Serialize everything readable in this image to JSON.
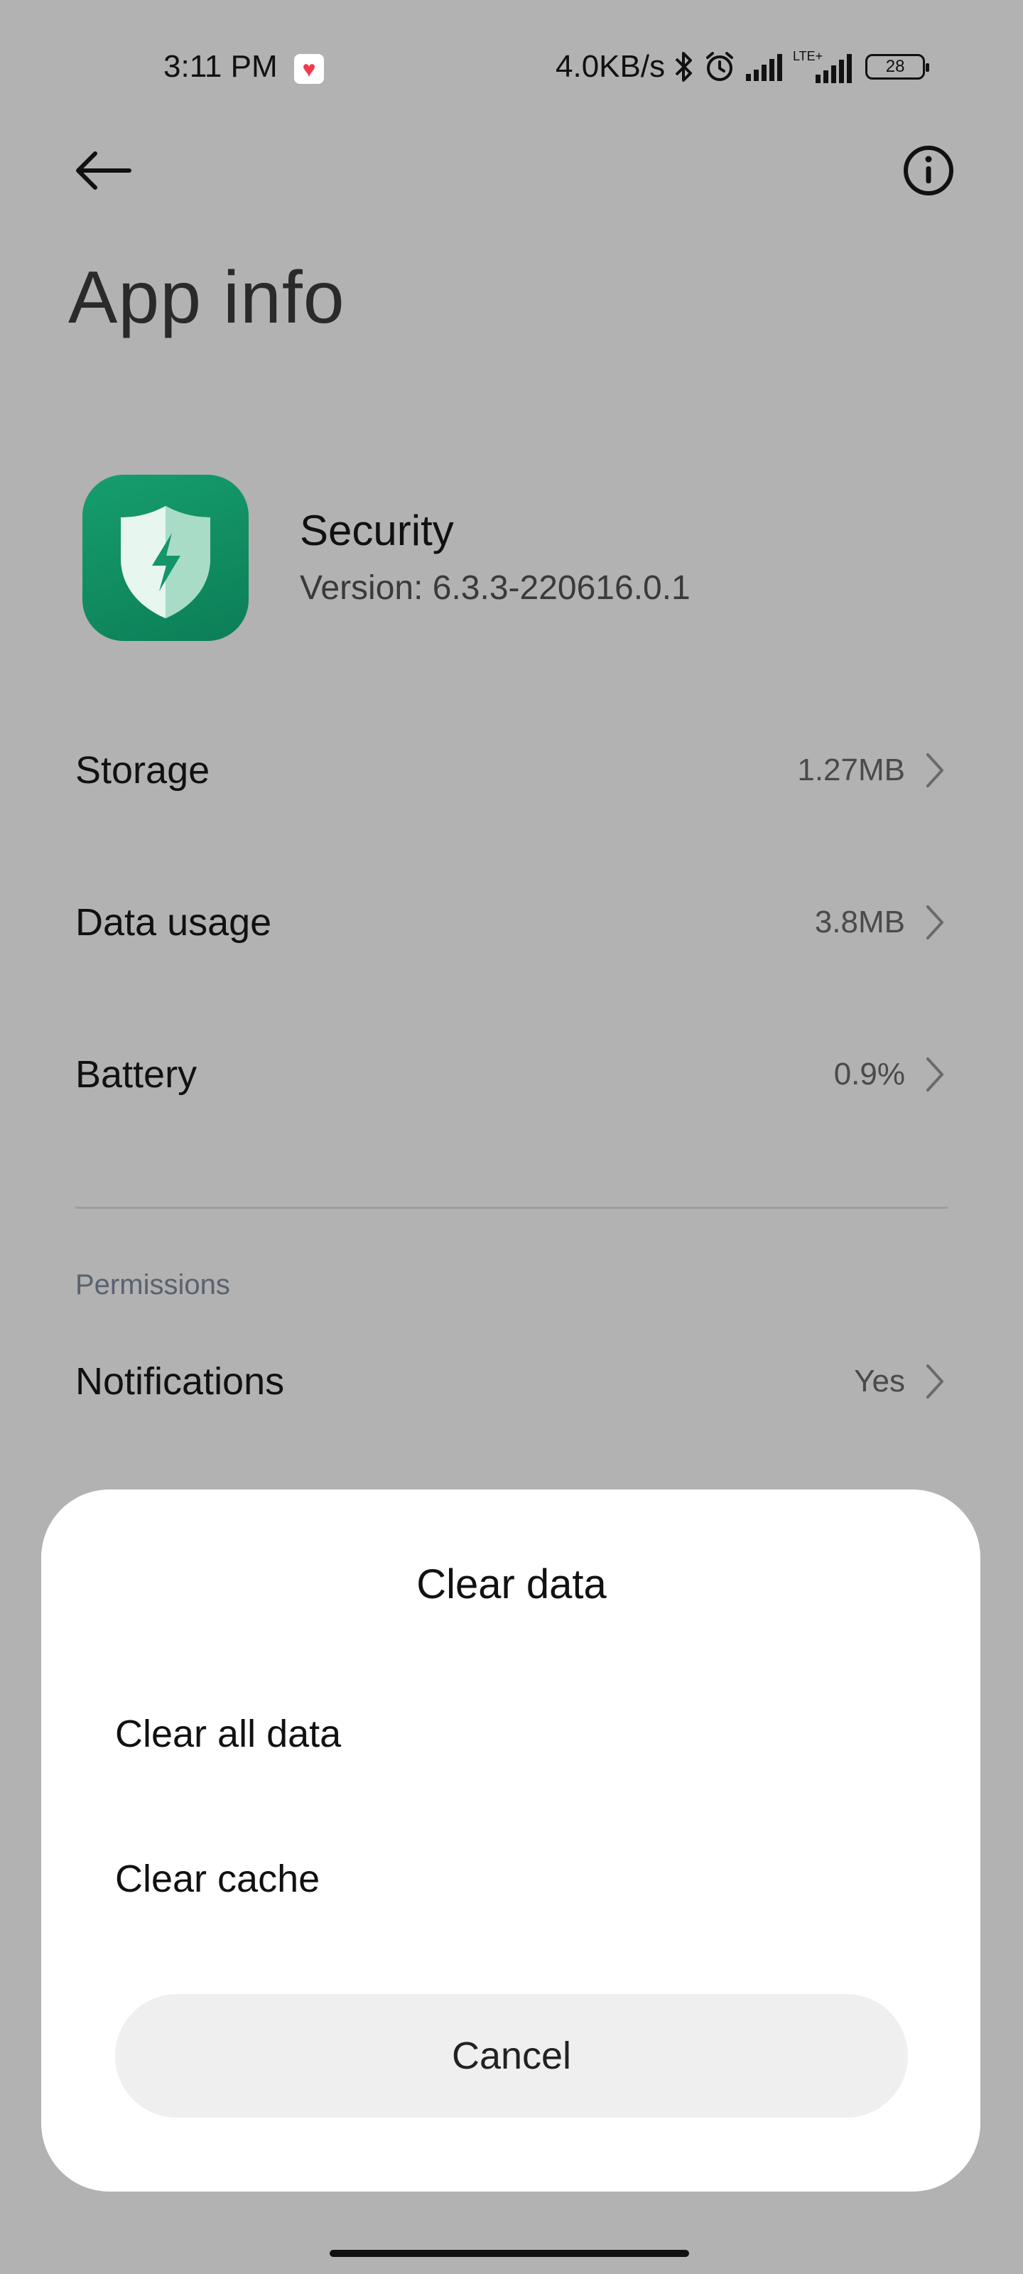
{
  "status_bar": {
    "time": "3:11 PM",
    "net_speed": "4.0KB/s",
    "network_type": "LTE+",
    "battery_level": "28",
    "icons": [
      "heart-notification-icon",
      "bluetooth-icon",
      "alarm-icon",
      "signal-icon",
      "lte-signal-icon",
      "battery-icon"
    ]
  },
  "header": {
    "back_icon": "arrow-left-icon",
    "info_icon": "info-circle-icon",
    "title": "App info"
  },
  "app": {
    "name": "Security",
    "version": "Version: 6.3.3-220616.0.1",
    "icon": "shield-lightning-icon",
    "icon_color": "#14956a"
  },
  "rows": [
    {
      "label": "Storage",
      "value": "1.27MB"
    },
    {
      "label": "Data usage",
      "value": "3.8MB"
    },
    {
      "label": "Battery",
      "value": "0.9%"
    }
  ],
  "permissions": {
    "section_label": "Permissions",
    "items": [
      {
        "label": "Notifications",
        "value": "Yes"
      }
    ]
  },
  "dialog": {
    "title": "Clear data",
    "options": [
      {
        "label": "Clear all data"
      },
      {
        "label": "Clear cache"
      }
    ],
    "cancel_label": "Cancel"
  },
  "colors": {
    "scrim_background": "#b2b2b2",
    "dialog_background": "#ffffff",
    "cancel_button_background": "#efefef"
  }
}
